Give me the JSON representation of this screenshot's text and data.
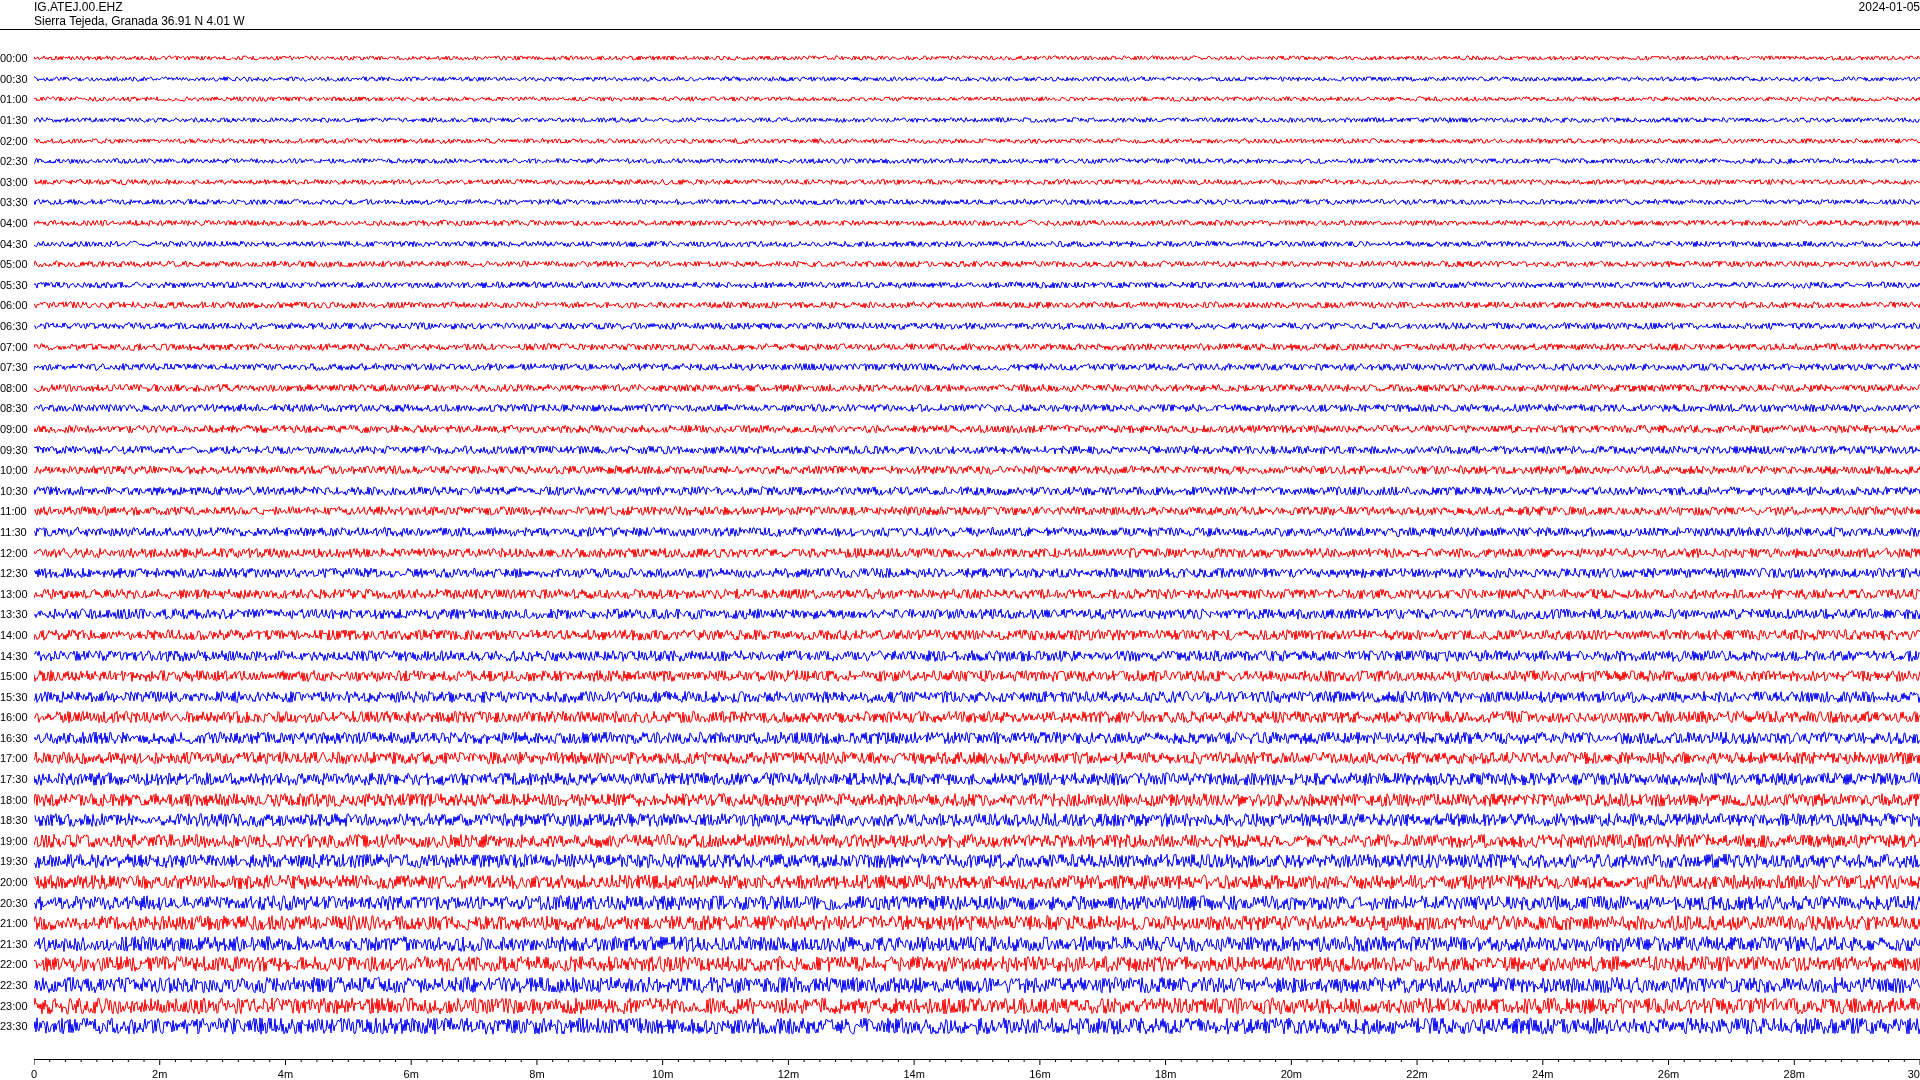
{
  "header": {
    "station": "IG.ATEJ.00.EHZ",
    "location": "Sierra Tejeda, Granada  36.91 N 4.01 W",
    "date": "2024-01-05"
  },
  "rows": [
    {
      "time": "00:00",
      "color": "#ff0000"
    },
    {
      "time": "00:30",
      "color": "#0000ff"
    },
    {
      "time": "01:00",
      "color": "#ff0000"
    },
    {
      "time": "01:30",
      "color": "#0000ff"
    },
    {
      "time": "02:00",
      "color": "#ff0000"
    },
    {
      "time": "02:30",
      "color": "#0000ff"
    },
    {
      "time": "03:00",
      "color": "#ff0000"
    },
    {
      "time": "03:30",
      "color": "#0000ff"
    },
    {
      "time": "04:00",
      "color": "#ff0000"
    },
    {
      "time": "04:30",
      "color": "#0000ff"
    },
    {
      "time": "05:00",
      "color": "#ff0000"
    },
    {
      "time": "05:30",
      "color": "#0000ff"
    },
    {
      "time": "06:00",
      "color": "#ff0000"
    },
    {
      "time": "06:30",
      "color": "#0000ff"
    },
    {
      "time": "07:00",
      "color": "#ff0000"
    },
    {
      "time": "07:30",
      "color": "#0000ff"
    },
    {
      "time": "08:00",
      "color": "#ff0000"
    },
    {
      "time": "08:30",
      "color": "#0000ff"
    },
    {
      "time": "09:00",
      "color": "#ff0000"
    },
    {
      "time": "09:30",
      "color": "#0000ff"
    },
    {
      "time": "10:00",
      "color": "#ff0000"
    },
    {
      "time": "10:30",
      "color": "#0000ff"
    },
    {
      "time": "11:00",
      "color": "#ff0000"
    },
    {
      "time": "11:30",
      "color": "#0000ff"
    },
    {
      "time": "12:00",
      "color": "#ff0000"
    },
    {
      "time": "12:30",
      "color": "#0000ff"
    },
    {
      "time": "13:00",
      "color": "#ff0000"
    },
    {
      "time": "13:30",
      "color": "#0000ff"
    },
    {
      "time": "14:00",
      "color": "#ff0000"
    },
    {
      "time": "14:30",
      "color": "#0000ff"
    },
    {
      "time": "15:00",
      "color": "#ff0000"
    },
    {
      "time": "15:30",
      "color": "#0000ff"
    },
    {
      "time": "16:00",
      "color": "#ff0000"
    },
    {
      "time": "16:30",
      "color": "#0000ff"
    },
    {
      "time": "17:00",
      "color": "#ff0000"
    },
    {
      "time": "17:30",
      "color": "#0000ff"
    },
    {
      "time": "18:00",
      "color": "#ff0000"
    },
    {
      "time": "18:30",
      "color": "#0000ff"
    },
    {
      "time": "19:00",
      "color": "#ff0000"
    },
    {
      "time": "19:30",
      "color": "#0000ff"
    },
    {
      "time": "20:00",
      "color": "#ff0000"
    },
    {
      "time": "20:30",
      "color": "#0000ff"
    },
    {
      "time": "21:00",
      "color": "#ff0000"
    },
    {
      "time": "21:30",
      "color": "#0000ff"
    },
    {
      "time": "22:00",
      "color": "#ff0000"
    },
    {
      "time": "22:30",
      "color": "#0000ff"
    },
    {
      "time": "23:00",
      "color": "#ff0000"
    },
    {
      "time": "23:30",
      "color": "#0000ff"
    }
  ],
  "x_axis": {
    "labels": [
      "0",
      "2m",
      "4m",
      "6m",
      "8m",
      "10m",
      "12m",
      "14m",
      "16m",
      "18m",
      "20m",
      "22m",
      "24m",
      "26m",
      "28m",
      "30"
    ]
  }
}
